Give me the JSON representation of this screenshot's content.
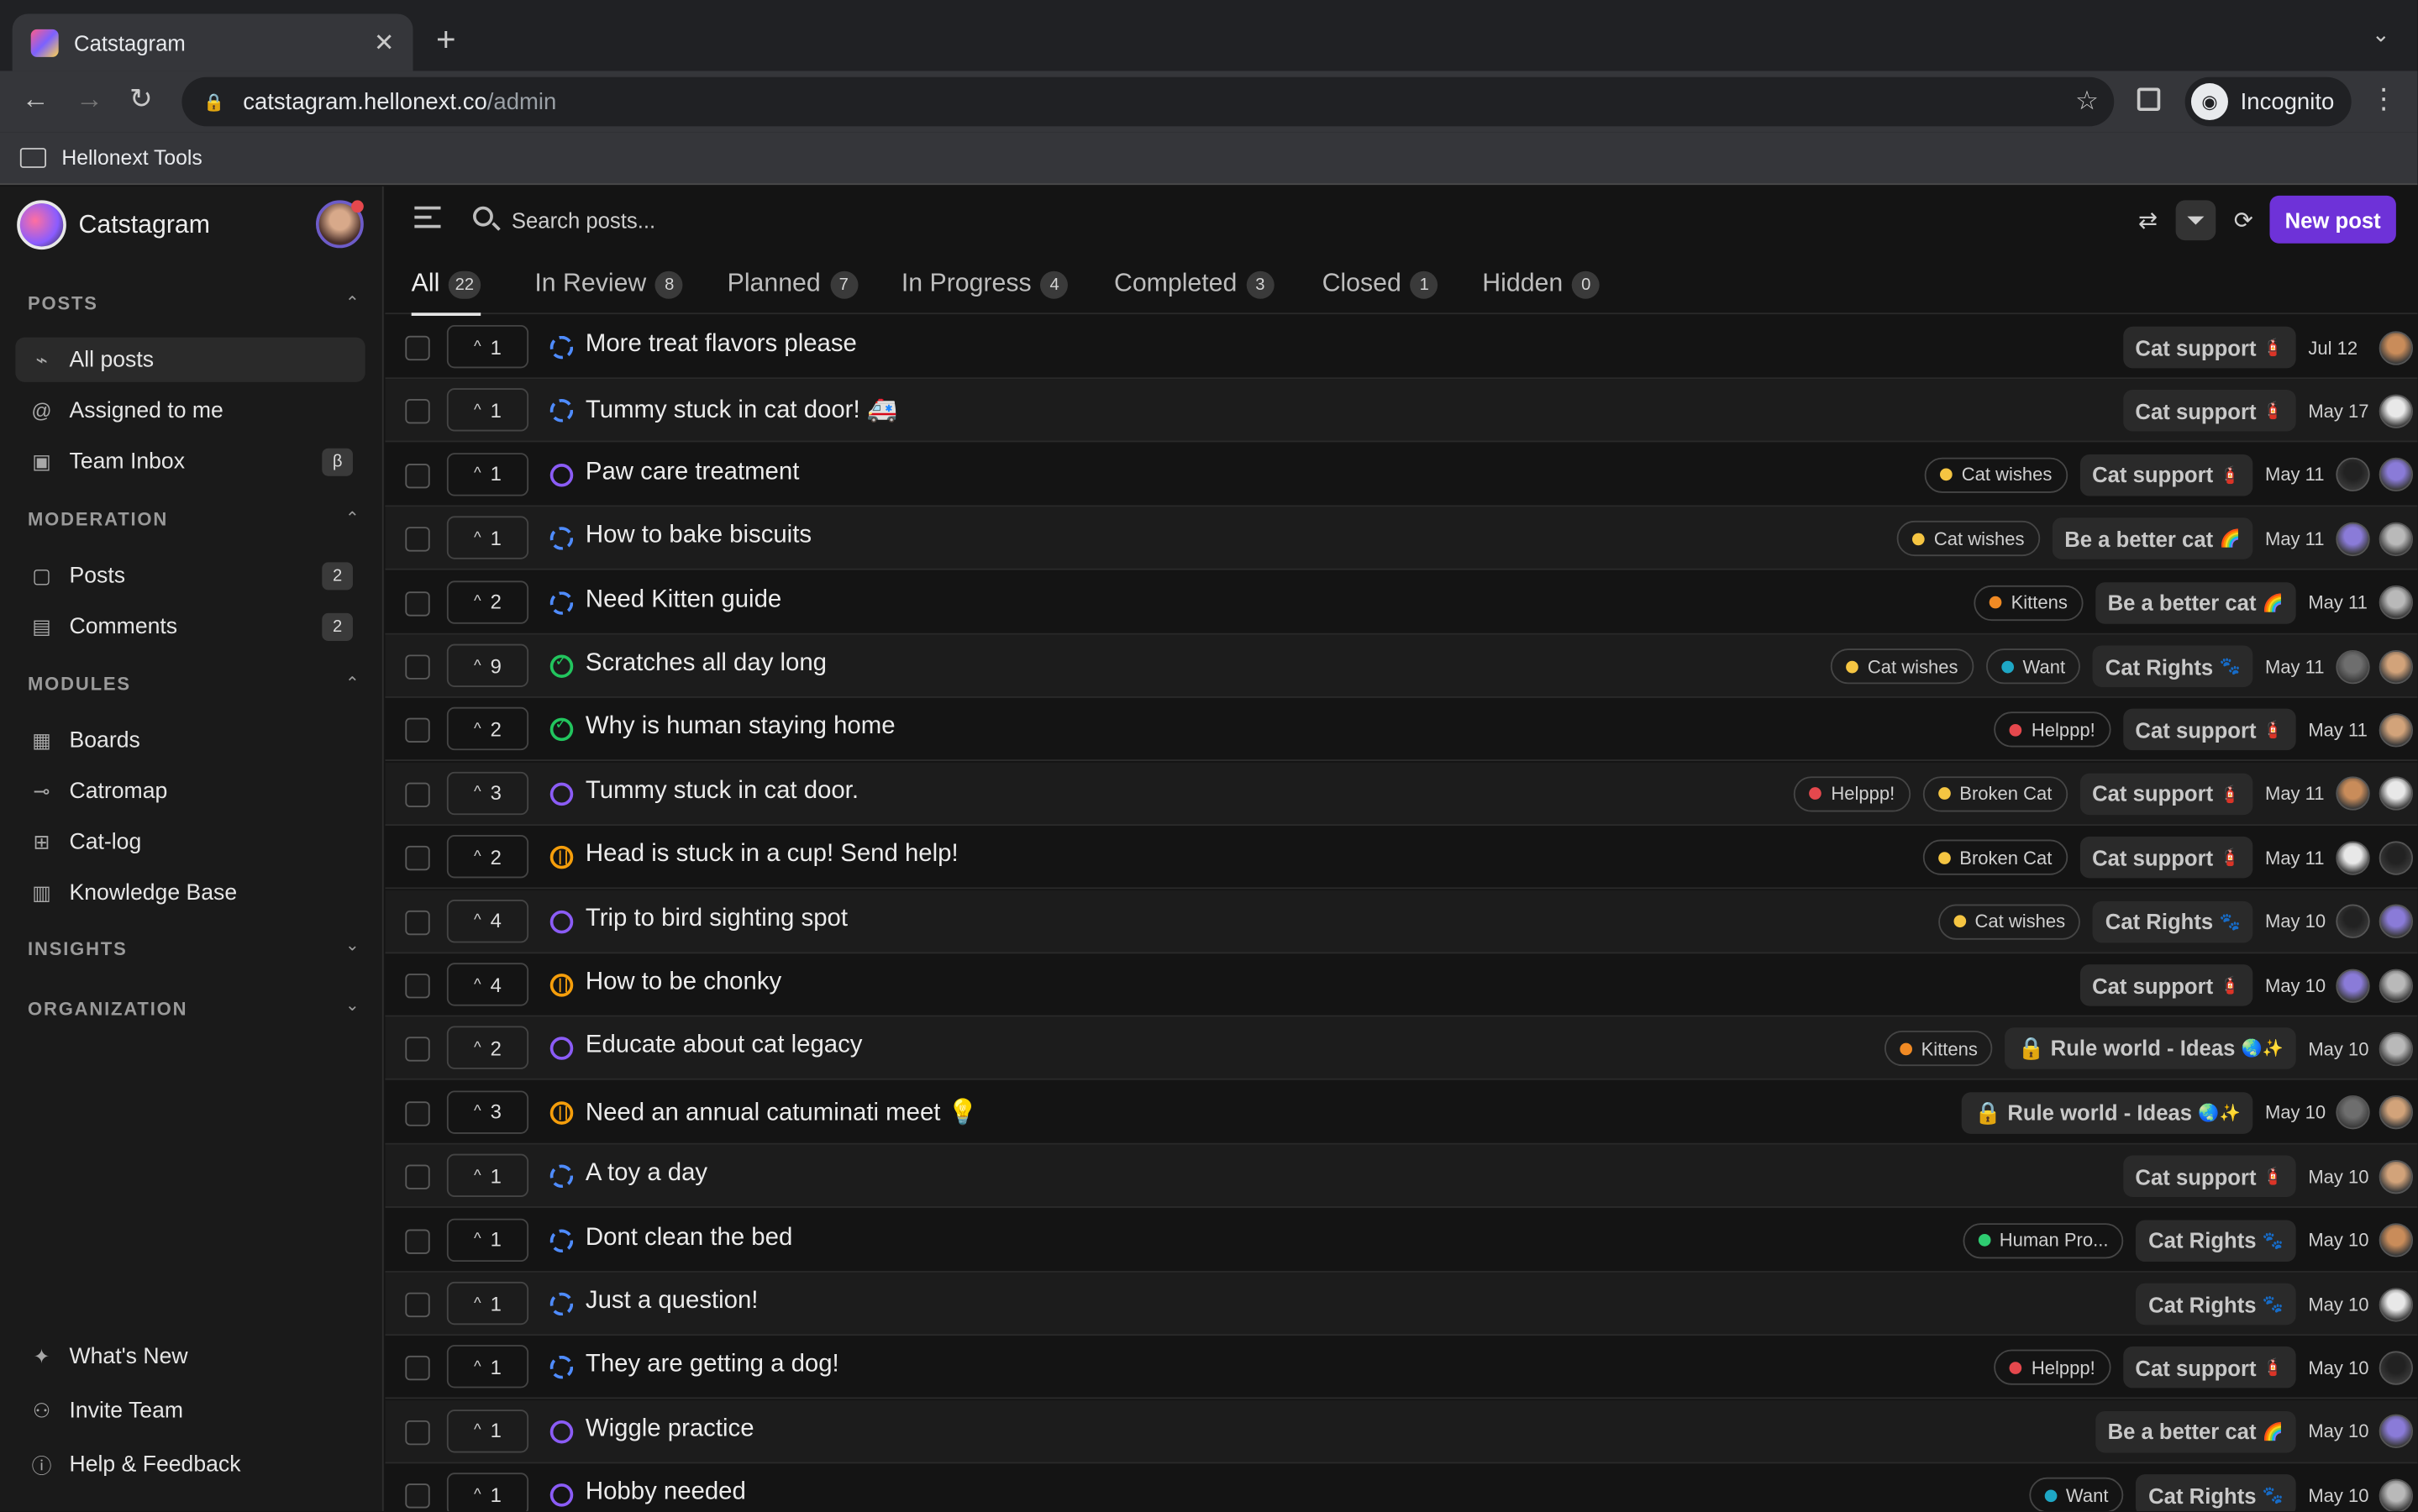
{
  "browser": {
    "tab_title": "Catstagram",
    "url_host": "catstagram.hellonext.co",
    "url_path": "/admin",
    "profile": "Incognito",
    "bookmark": "Hellonext Tools"
  },
  "sidebar": {
    "brand": "Catstagram",
    "posts_header": "POSTS",
    "posts_items": [
      {
        "label": "All posts",
        "icon": "rss-icon"
      },
      {
        "label": "Assigned to me",
        "icon": "at-icon"
      },
      {
        "label": "Team Inbox",
        "icon": "inbox-icon",
        "badge": "β"
      }
    ],
    "moderation_header": "MODERATION",
    "moderation_items": [
      {
        "label": "Posts",
        "count": "2"
      },
      {
        "label": "Comments",
        "count": "2"
      }
    ],
    "modules_header": "MODULES",
    "modules_items": [
      {
        "label": "Boards"
      },
      {
        "label": "Catromap"
      },
      {
        "label": "Cat-log"
      },
      {
        "label": "Knowledge Base"
      }
    ],
    "insights_header": "INSIGHTS",
    "organization_header": "ORGANIZATION",
    "footer_items": [
      {
        "label": "What's New"
      },
      {
        "label": "Invite Team"
      },
      {
        "label": "Help & Feedback"
      }
    ]
  },
  "topbar": {
    "search_placeholder": "Search posts...",
    "new_post": "New post"
  },
  "status_tabs": [
    {
      "label": "All",
      "count": "22"
    },
    {
      "label": "In Review",
      "count": "8"
    },
    {
      "label": "Planned",
      "count": "7"
    },
    {
      "label": "In Progress",
      "count": "4"
    },
    {
      "label": "Completed",
      "count": "3"
    },
    {
      "label": "Closed",
      "count": "1"
    },
    {
      "label": "Hidden",
      "count": "0"
    }
  ],
  "colors": {
    "accent": "#6e32d8",
    "in_review": "#4f8cff",
    "planned": "#8b5cf6",
    "completed": "#22c55e",
    "in_progress": "#f59e0b",
    "tag_yellow": "#f5c542",
    "tag_orange": "#f08a24",
    "tag_teal": "#1ea7c5",
    "tag_red": "#e5484d",
    "tag_green": "#2ecc71"
  },
  "posts": [
    {
      "votes": "1",
      "title": "More treat flavors please",
      "status": "review",
      "tags": [],
      "board": "Cat support",
      "board_icon": "🧯",
      "date": "Jul 12",
      "avatars": 1
    },
    {
      "votes": "1",
      "title": "Tummy stuck in cat door! 🚑",
      "status": "review",
      "tags": [],
      "board": "Cat support",
      "board_icon": "🧯",
      "date": "May 17",
      "avatars": 1
    },
    {
      "votes": "1",
      "title": "Paw care treatment",
      "status": "planned",
      "tags": [
        {
          "label": "Cat wishes",
          "color": "#f5c542"
        }
      ],
      "board": "Cat support",
      "board_icon": "🧯",
      "date": "May 11",
      "avatars": 2
    },
    {
      "votes": "1",
      "title": "How to bake biscuits",
      "status": "review",
      "tags": [
        {
          "label": "Cat wishes",
          "color": "#f5c542"
        }
      ],
      "board": "Be a better cat",
      "board_icon": "🌈",
      "date": "May 11",
      "avatars": 2
    },
    {
      "votes": "2",
      "title": "Need Kitten guide",
      "status": "review",
      "tags": [
        {
          "label": "Kittens",
          "color": "#f08a24"
        }
      ],
      "board": "Be a better cat",
      "board_icon": "🌈",
      "date": "May 11",
      "avatars": 1
    },
    {
      "votes": "9",
      "title": "Scratches all day long",
      "status": "done",
      "tags": [
        {
          "label": "Cat wishes",
          "color": "#f5c542"
        },
        {
          "label": "Want",
          "color": "#1ea7c5"
        }
      ],
      "board": "Cat Rights",
      "board_icon": "🐾",
      "date": "May 11",
      "avatars": 2
    },
    {
      "votes": "2",
      "title": "Why is human staying home",
      "status": "done",
      "tags": [
        {
          "label": "Helppp!",
          "color": "#e5484d"
        }
      ],
      "board": "Cat support",
      "board_icon": "🧯",
      "date": "May 11",
      "avatars": 1
    },
    {
      "votes": "3",
      "title": "Tummy stuck in cat door.",
      "status": "planned",
      "tags": [
        {
          "label": "Helppp!",
          "color": "#e5484d"
        },
        {
          "label": "Broken Cat",
          "color": "#f5c542"
        }
      ],
      "board": "Cat support",
      "board_icon": "🧯",
      "date": "May 11",
      "avatars": 2
    },
    {
      "votes": "2",
      "title": "Head is stuck in a cup! Send help!",
      "status": "progress",
      "tags": [
        {
          "label": "Broken Cat",
          "color": "#f5c542"
        }
      ],
      "board": "Cat support",
      "board_icon": "🧯",
      "date": "May 11",
      "avatars": 2
    },
    {
      "votes": "4",
      "title": "Trip to bird sighting spot",
      "status": "planned",
      "tags": [
        {
          "label": "Cat wishes",
          "color": "#f5c542"
        }
      ],
      "board": "Cat Rights",
      "board_icon": "🐾",
      "date": "May 10",
      "avatars": 2
    },
    {
      "votes": "4",
      "title": "How to be chonky",
      "status": "progress",
      "tags": [],
      "board": "Cat support",
      "board_icon": "🧯",
      "date": "May 10",
      "avatars": 2
    },
    {
      "votes": "2",
      "title": "Educate about cat legacy",
      "status": "planned",
      "tags": [
        {
          "label": "Kittens",
          "color": "#f08a24"
        }
      ],
      "board": "🔒 Rule world - Ideas",
      "board_icon": "🌏✨",
      "date": "May 10",
      "avatars": 1
    },
    {
      "votes": "3",
      "title": "Need an annual catuminati meet 💡",
      "status": "progress",
      "tags": [],
      "board": "🔒 Rule world - Ideas",
      "board_icon": "🌏✨",
      "date": "May 10",
      "avatars": 2
    },
    {
      "votes": "1",
      "title": "A toy a day",
      "status": "review",
      "tags": [],
      "board": "Cat support",
      "board_icon": "🧯",
      "date": "May 10",
      "avatars": 1
    },
    {
      "votes": "1",
      "title": "Dont clean the bed",
      "status": "review",
      "tags": [
        {
          "label": "Human Pro...",
          "color": "#2ecc71"
        }
      ],
      "board": "Cat Rights",
      "board_icon": "🐾",
      "date": "May 10",
      "avatars": 1
    },
    {
      "votes": "1",
      "title": "Just a question!",
      "status": "review",
      "tags": [],
      "board": "Cat Rights",
      "board_icon": "🐾",
      "date": "May 10",
      "avatars": 1
    },
    {
      "votes": "1",
      "title": "They are getting a dog!",
      "status": "review",
      "tags": [
        {
          "label": "Helppp!",
          "color": "#e5484d"
        }
      ],
      "board": "Cat support",
      "board_icon": "🧯",
      "date": "May 10",
      "avatars": 1
    },
    {
      "votes": "1",
      "title": "Wiggle practice",
      "status": "planned",
      "tags": [],
      "board": "Be a better cat",
      "board_icon": "🌈",
      "date": "May 10",
      "avatars": 1
    },
    {
      "votes": "1",
      "title": "Hobby needed",
      "status": "planned",
      "tags": [
        {
          "label": "Want",
          "color": "#1ea7c5"
        }
      ],
      "board": "Cat Rights",
      "board_icon": "🐾",
      "date": "May 10",
      "avatars": 1
    }
  ]
}
